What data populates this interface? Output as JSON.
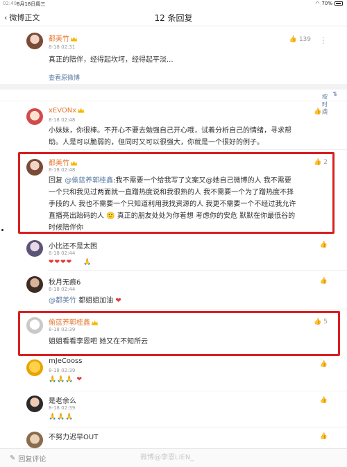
{
  "status": {
    "time": "02:49",
    "date": "8月18日周三",
    "battery": "70%"
  },
  "nav": {
    "back_label": "微博正文",
    "title": "12 条回复"
  },
  "original": {
    "user": "都美竹",
    "time": "8-18 02:31",
    "text": "真正的陪伴，经得起坎坷，经得起平淡...",
    "likes": "139",
    "view_original": "查看原微博"
  },
  "sort_label": "按时间",
  "comments": [
    {
      "user": "xEVONx",
      "time": "8-18 02:48",
      "text_lines": [
        "小妹妹，你很棒。不开心不要去勉强自己开心哦，试着分析自己的情绪，寻求帮",
        "助。人是可以脆弱的，但同时又可以很强大，你就是一个很好的例子。"
      ],
      "likes": "1"
    },
    {
      "user": "都美竹",
      "time": "8-18 02:48",
      "reply_prefix": "回复",
      "mention": "@偷蓝养郭桂鑫",
      "text_lines": [
        ":我不需要一个给我写了文案又@她自己微博的人 我不需要",
        "一个只和我见过两面就一直蹭热度说和我很熟的人 我不需要一个为了蹭热度不择",
        "手段的人 我也不需要一个只知道利用我找资源的人 我更不需要一个不经过我允许",
        "直播亮出跆码的人 🙂 真正的朋友处处为你着想 考虑你的安危 默默在你最低谷的",
        "时候陪伴你"
      ],
      "likes": "2"
    },
    {
      "user": "小比还不是太困",
      "time": "8-18 02:44",
      "hearts": "❤❤❤❤",
      "emojis": "🙏"
    },
    {
      "user": "秋月无痕6",
      "time": "8-18 02:44",
      "mention": "@都美竹",
      "text": "都姐姐加油",
      "heart": "❤"
    },
    {
      "user": "偷蓝养郭桂鑫",
      "time": "8-18 02:39",
      "text": "姐姐看看李恩吧 她又在不知所云",
      "likes": "5"
    },
    {
      "user": "mJeCooss",
      "time": "8-18 02:39",
      "emojis": "🙏🙏🙏",
      "heart": "❤"
    },
    {
      "user": "是老余么",
      "time": "8-18 02:39",
      "emojis": "🙏🙏🙏"
    },
    {
      "user": "不努力迟早OUT",
      "time": ""
    }
  ],
  "bottom": {
    "placeholder": "回复评论",
    "watermark": "微博@李恩LIEN_"
  }
}
